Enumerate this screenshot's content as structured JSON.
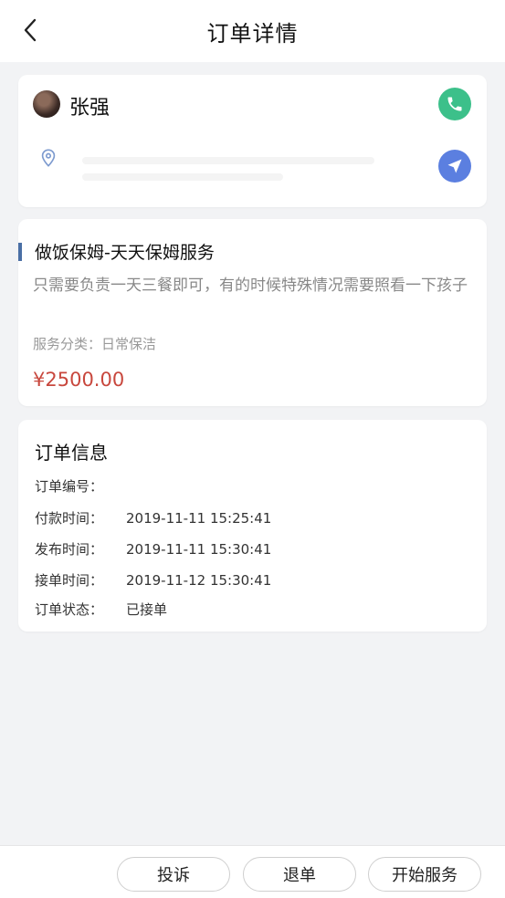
{
  "header": {
    "title": "订单详情"
  },
  "customer": {
    "name": "张强"
  },
  "service": {
    "title": "做饭保姆-天天保姆服务",
    "description": "只需要负责一天三餐即可，有的时候特殊情况需要照看一下孩子",
    "category_label": "服务分类：",
    "category_value": "日常保洁",
    "price": "¥2500.00"
  },
  "order_info": {
    "heading": "订单信息",
    "rows": [
      {
        "label": "订单编号：",
        "value": ""
      },
      {
        "label": "付款时间：",
        "value": "2019-11-11 15:25:41"
      },
      {
        "label": "发布时间：",
        "value": "2019-11-11 15:30:41"
      },
      {
        "label": "接单时间：",
        "value": "2019-11-12 15:30:41"
      },
      {
        "label": "订单状态：",
        "value": "已接单"
      }
    ]
  },
  "actions": {
    "complain": "投诉",
    "cancel": "退单",
    "start": "开始服务"
  },
  "colors": {
    "call": "#3cc08a",
    "navigate": "#5b7fe0",
    "price": "#c8473d",
    "accent": "#4a6fa5"
  },
  "icons": [
    "back-arrow-icon",
    "phone-icon",
    "location-pin-icon",
    "navigation-arrow-icon",
    "avatar"
  ]
}
